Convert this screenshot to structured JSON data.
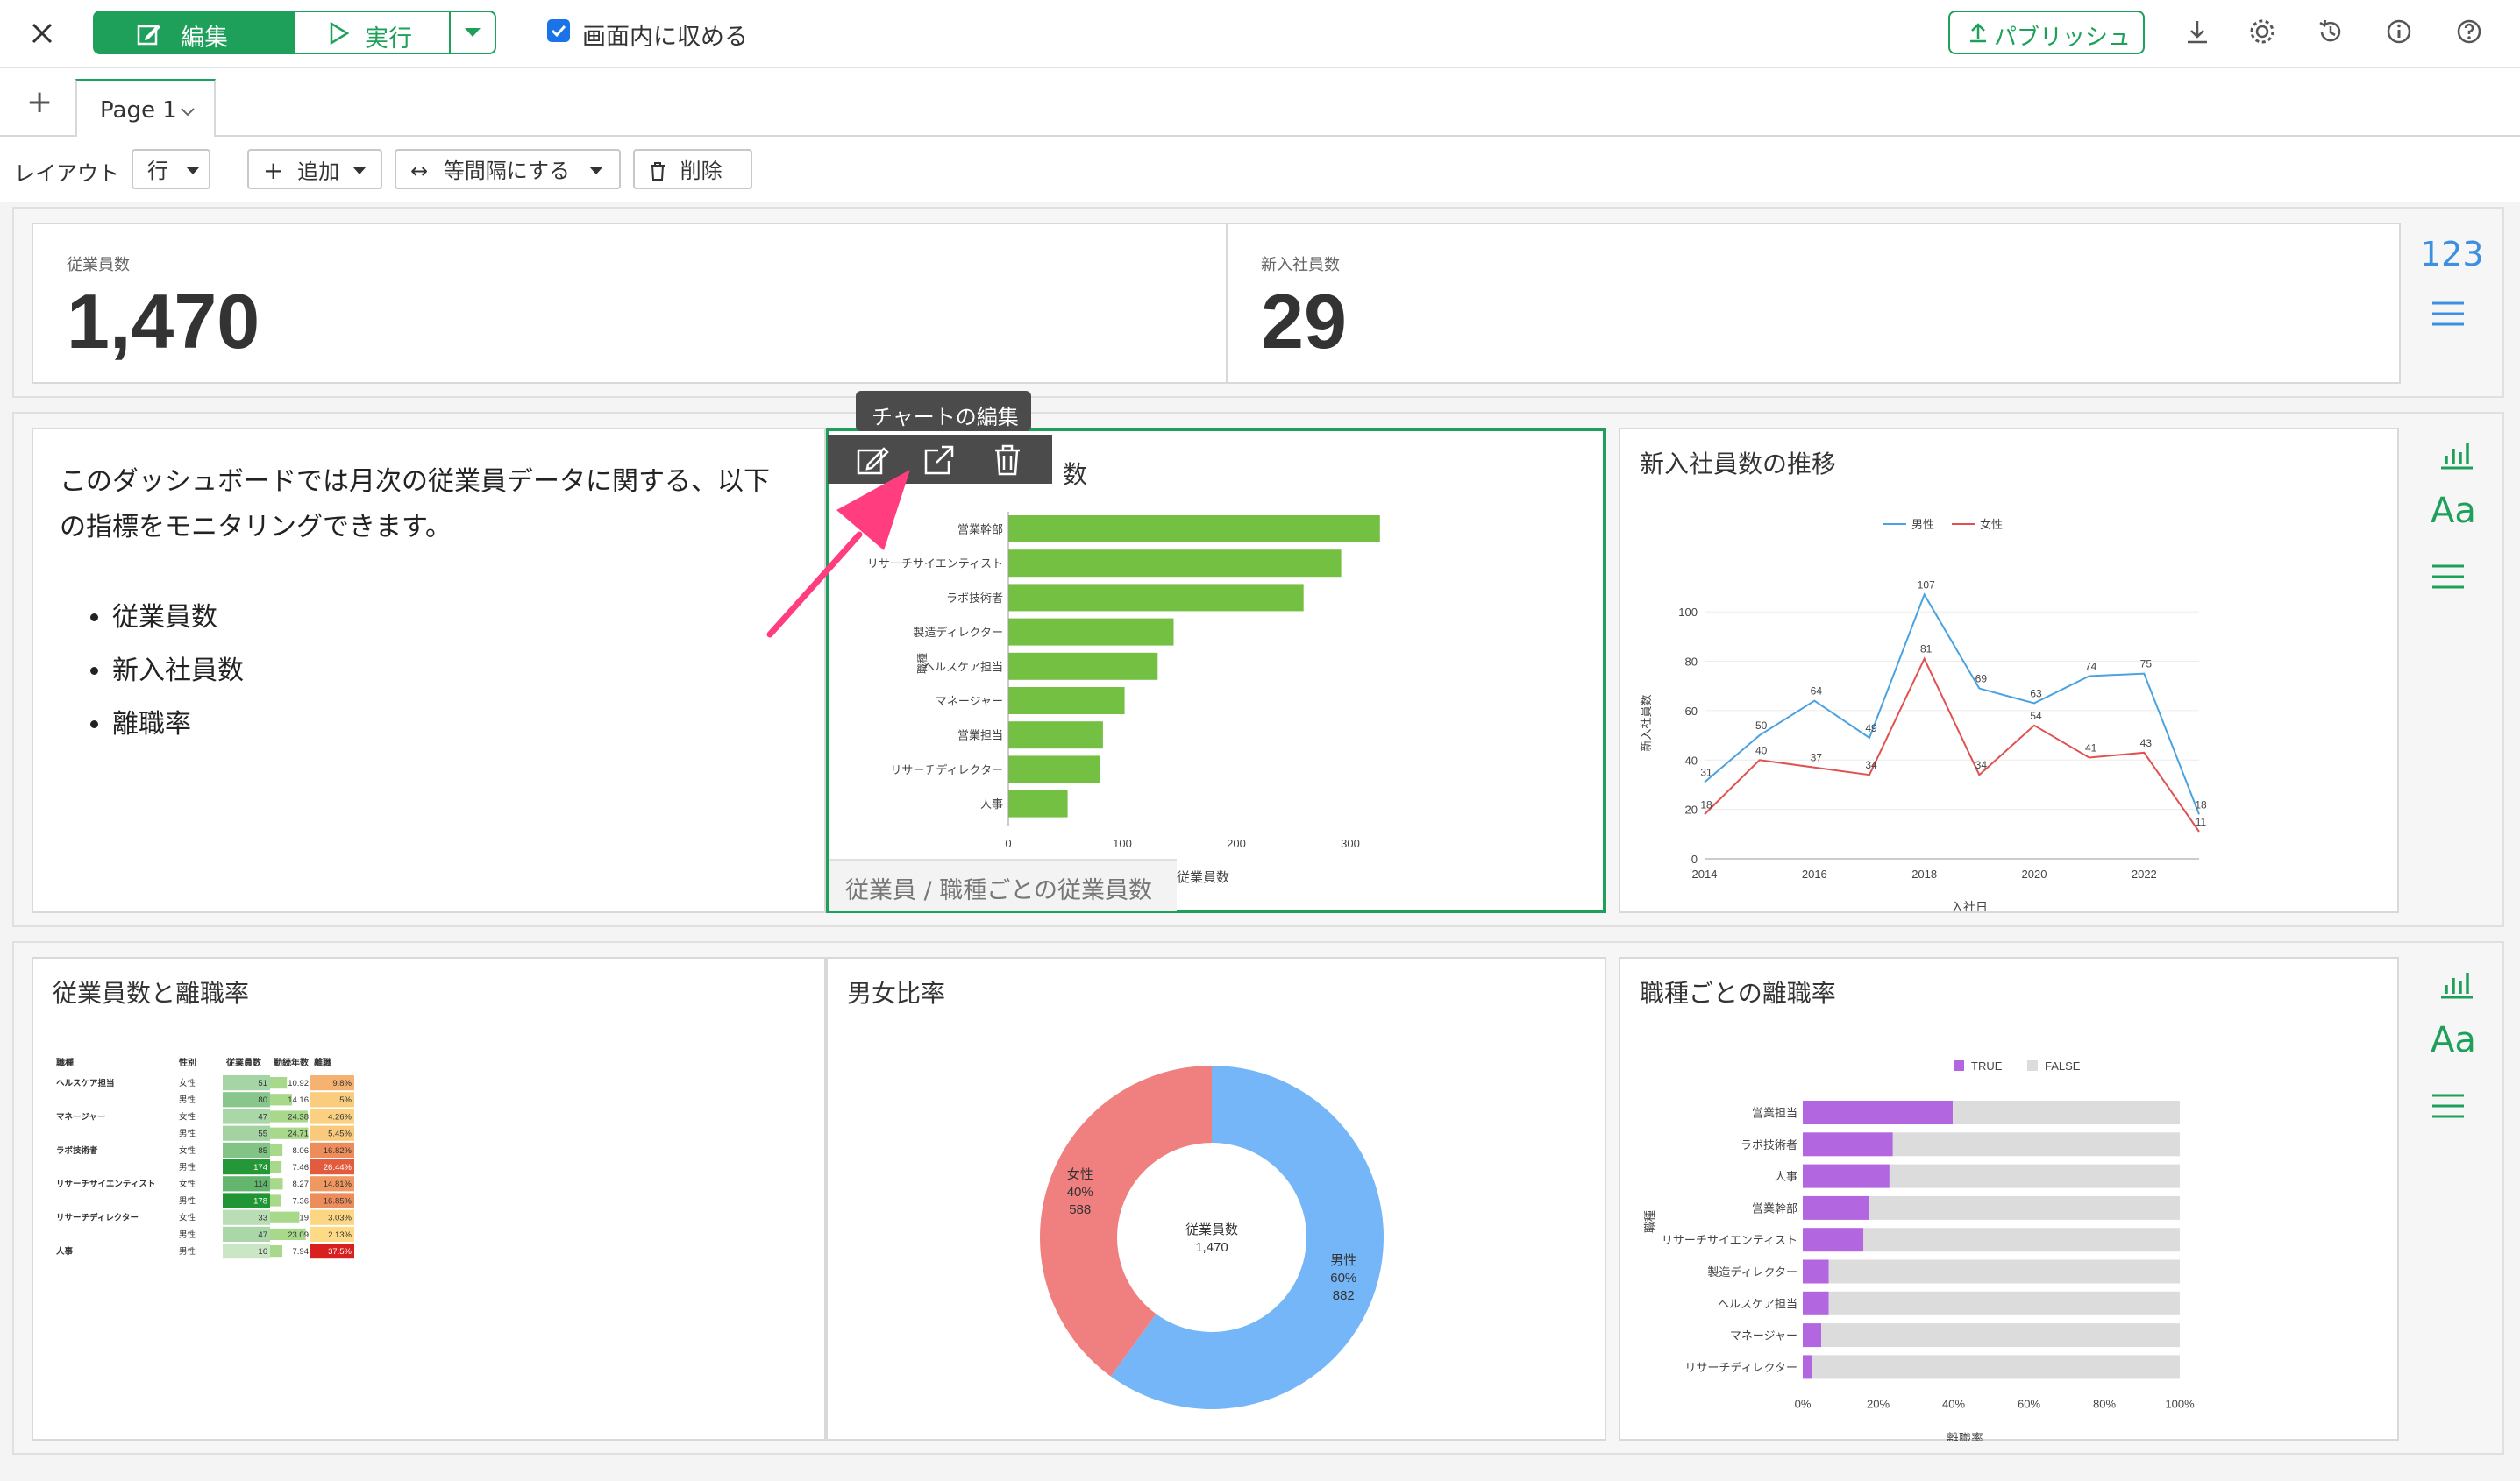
{
  "toolbar": {
    "edit_label": "編集",
    "run_label": "実行",
    "fit_label": "画面内に収める",
    "publish_label": "パブリッシュ"
  },
  "tabs": {
    "add_label": "+",
    "page_label": "Page 1"
  },
  "layout": {
    "label": "レイアウト",
    "row_label": "行",
    "add_label": "追加",
    "spacing_label": "等間隔にする",
    "delete_label": "削除"
  },
  "kpi": [
    {
      "label": "従業員数",
      "value": "1,470"
    },
    {
      "label": "新入社員数",
      "value": "29"
    }
  ],
  "side": {
    "number_label": "123",
    "text_label": "Aa"
  },
  "description": {
    "text": "このダッシュボードでは月次の従業員データに関する、以下の指標をモニタリングできます。",
    "bullets": [
      "従業員数",
      "新入社員数",
      "離職率"
    ]
  },
  "tooltip": "チャートの編集",
  "bar_panel": {
    "title_visible": "数",
    "footer": "従業員 / 職種ごとの従業員数",
    "chart_data": {
      "type": "bar",
      "categories": [
        "営業幹部",
        "リサーチサイエンティスト",
        "ラボ技術者",
        "製造ディレクター",
        "ヘルスケア担当",
        "マネージャー",
        "営業担当",
        "リサーチディレクター",
        "人事"
      ],
      "values": [
        326,
        292,
        259,
        145,
        131,
        102,
        83,
        80,
        52
      ],
      "xlabel": "従業員数",
      "ylabel": "職種",
      "xticks": [
        "0",
        "100",
        "200",
        "300"
      ],
      "xlim": [
        0,
        340
      ],
      "color": "#74c043"
    }
  },
  "line_panel": {
    "title": "新入社員数の推移",
    "chart_data": {
      "type": "line",
      "x": [
        2014,
        2015,
        2016,
        2017,
        2018,
        2019,
        2020,
        2021,
        2022,
        2023
      ],
      "series": [
        {
          "name": "男性",
          "color": "#4aa3e0",
          "values": [
            31,
            50,
            64,
            49,
            107,
            69,
            63,
            74,
            75,
            18
          ],
          "labels": [
            "31",
            "50",
            "64",
            "49",
            "107",
            "69",
            "63",
            "74",
            "75",
            "18"
          ]
        },
        {
          "name": "女性",
          "color": "#e05252",
          "values": [
            18,
            40,
            37,
            34,
            81,
            34,
            54,
            41,
            43,
            11
          ],
          "labels": [
            "18",
            "40",
            "37",
            "34",
            "81",
            "34",
            "54",
            "41",
            "43",
            "11"
          ]
        }
      ],
      "xlabel": "入社日",
      "ylabel": "新入社員数",
      "xticks": [
        "2014",
        "2016",
        "2018",
        "2020",
        "2022"
      ],
      "yticks": [
        "0",
        "20",
        "40",
        "60",
        "80",
        "100"
      ],
      "ylim": [
        0,
        110
      ]
    }
  },
  "table_panel": {
    "title": "従業員数と離職率",
    "headers": [
      "職種",
      "性別",
      "従業員数",
      "勤続年数",
      "離職"
    ],
    "rows": [
      [
        "ヘルスケア担当",
        "女性",
        "51",
        "10.92",
        "9.8%"
      ],
      [
        "",
        "男性",
        "80",
        "14.16",
        "5%"
      ],
      [
        "マネージャー",
        "女性",
        "47",
        "24.38",
        "4.26%"
      ],
      [
        "",
        "男性",
        "55",
        "24.71",
        "5.45%"
      ],
      [
        "ラボ技術者",
        "女性",
        "85",
        "8.06",
        "16.82%"
      ],
      [
        "",
        "男性",
        "174",
        "7.46",
        "26.44%"
      ],
      [
        "リサーチサイエンティスト",
        "女性",
        "114",
        "8.27",
        "14.81%"
      ],
      [
        "",
        "男性",
        "178",
        "7.36",
        "16.85%"
      ],
      [
        "リサーチディレクター",
        "女性",
        "33",
        "19",
        "3.03%"
      ],
      [
        "",
        "男性",
        "47",
        "23.09",
        "2.13%"
      ],
      [
        "人事",
        "男性",
        "16",
        "7.94",
        "37.5%"
      ]
    ]
  },
  "donut_panel": {
    "title": "男女比率",
    "center_label": "従業員数",
    "center_value": "1,470",
    "chart_data": {
      "type": "pie",
      "slices": [
        {
          "name": "男性",
          "value": 882,
          "pct": "60%",
          "color": "#74b6f7"
        },
        {
          "name": "女性",
          "value": 588,
          "pct": "40%",
          "color": "#f07f7f"
        }
      ]
    }
  },
  "stacked_panel": {
    "title": "職種ごとの離職率",
    "chart_data": {
      "type": "bar",
      "categories": [
        "営業担当",
        "ラボ技術者",
        "人事",
        "営業幹部",
        "リサーチサイエンティスト",
        "製造ディレクター",
        "ヘルスケア担当",
        "マネージャー",
        "リサーチディレクター"
      ],
      "series": [
        {
          "name": "TRUE",
          "color": "#b266e0",
          "values": [
            39.8,
            23.9,
            23.0,
            17.5,
            16.1,
            6.9,
            6.9,
            4.9,
            2.5
          ]
        },
        {
          "name": "FALSE",
          "color": "#dcdcdc",
          "values": [
            60.2,
            76.1,
            77.0,
            82.5,
            83.9,
            93.1,
            93.1,
            95.1,
            97.5
          ]
        }
      ],
      "xlabel": "離職率",
      "ylabel": "職種",
      "xticks": [
        "0%",
        "20%",
        "40%",
        "60%",
        "80%",
        "100%"
      ],
      "xlim": [
        0,
        100
      ]
    }
  }
}
